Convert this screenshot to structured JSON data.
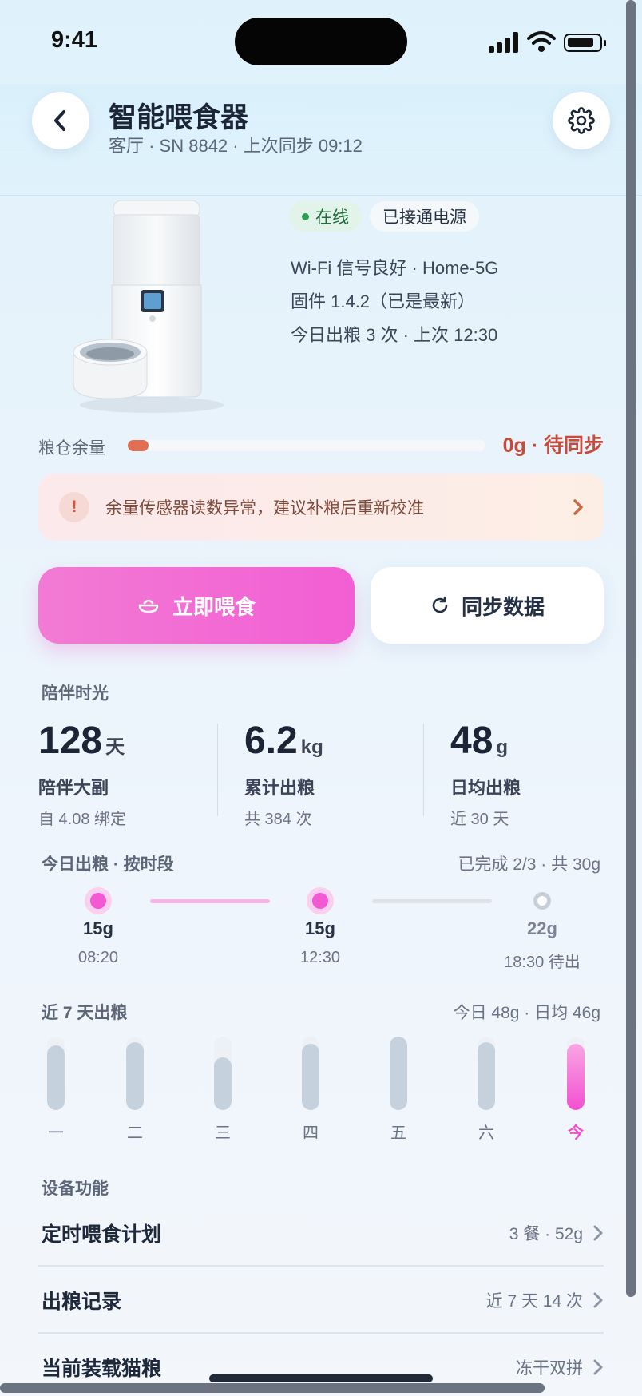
{
  "status_bar": {
    "time": "9:41"
  },
  "header": {
    "title": "智能喂食器",
    "subtitle": "客厅 · SN 8842 · 上次同步 09:12"
  },
  "device": {
    "status_online": "在线",
    "status_power": "已接通电源",
    "wifi": "Wi-Fi 信号良好 · Home-5G",
    "firmware": "固件 1.4.2（已是最新）",
    "today_summary": "今日出粮 3 次 · 上次 12:30"
  },
  "food": {
    "label": "粮仓余量",
    "value": "0g · 待同步",
    "level_fraction": 0.04
  },
  "alert": {
    "icon": "!",
    "text": "余量传感器读数异常，建议补粮后重新校准"
  },
  "actions": {
    "feed_label": "立即喂食",
    "sync_label": "同步数据"
  },
  "companion": {
    "title": "陪伴时光",
    "stats": [
      {
        "num": "128",
        "unit": "天",
        "label": "陪伴大副",
        "sub": "自 4.08 绑定"
      },
      {
        "num": "6.2",
        "unit": "kg",
        "label": "累计出粮",
        "sub": "共 384 次"
      },
      {
        "num": "48",
        "unit": "g",
        "label": "日均出粮",
        "sub": "近 30 天"
      }
    ]
  },
  "today_feed": {
    "title": "今日出粮 · 按时段",
    "summary": "已完成 2/3 · 共 30g",
    "slots": [
      {
        "grams": "15g",
        "time": "08:20",
        "done": true
      },
      {
        "grams": "15g",
        "time": "12:30",
        "done": true
      },
      {
        "grams": "22g",
        "time": "18:30 待出",
        "done": false
      }
    ]
  },
  "week": {
    "title": "近 7 天出粮",
    "summary": "今日 48g · 日均 46g",
    "days": [
      "一",
      "二",
      "三",
      "四",
      "五",
      "六",
      "今"
    ],
    "levels": [
      0.88,
      0.92,
      0.72,
      0.9,
      1.0,
      0.92,
      0.9
    ]
  },
  "functions": {
    "title": "设备功能",
    "rows": [
      {
        "title": "定时喂食计划",
        "value": "3 餐 · 52g"
      },
      {
        "title": "出粮记录",
        "value": "近 7 天 14 次"
      },
      {
        "title": "当前装载猫粮",
        "value": "冻干双拼"
      }
    ]
  },
  "colors": {
    "accent": "#f25ed4",
    "warning": "#c84a3a",
    "online": "#2f9e58"
  }
}
